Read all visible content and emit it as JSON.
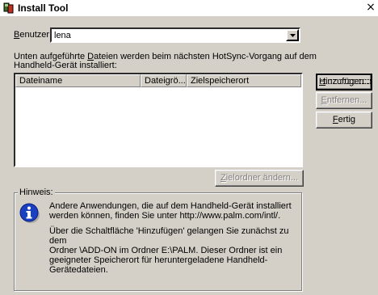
{
  "window": {
    "title": "Install Tool",
    "close_glyph": "×",
    "icon": "install-tool-icon"
  },
  "user": {
    "label_prefix": "",
    "label_accel": "B",
    "label_rest": "enutzer:",
    "value": "lena"
  },
  "description": {
    "line1_pre": "Unten aufgeführte ",
    "line1_accel": "D",
    "line1_post": "ateien werden beim nächsten HotSync-Vorgang auf dem",
    "line2": "Handheld-Gerät installiert:"
  },
  "file_list": {
    "columns": [
      "Dateiname",
      "Dateigrö...",
      "Zielspeicherort"
    ],
    "rows": []
  },
  "buttons": {
    "add_accel": "H",
    "add_rest": "inzufügen...",
    "remove_accel": "E",
    "remove_rest": "ntfernen...",
    "done_accel": "F",
    "done_rest": "ertig",
    "change_folder_accel": "Z",
    "change_folder_rest": "ielordner ändern..."
  },
  "hint": {
    "title": "Hinweis:",
    "p1_line1": "Andere Anwendungen, die auf dem Handheld-Gerät installiert",
    "p1_line2": "werden können, finden Sie unter http://www.palm.com/intl/.",
    "p2_line1": "Über die Schaltfläche 'Hinzufügen' gelangen Sie zunächst zu dem",
    "p2_line2": "Ordner \\ADD-ON im Ordner E:\\PALM. Dieser Ordner ist ein",
    "p2_line3": "geeigneter Speicherort für heruntergeladene Handheld-Gerätedateien."
  },
  "colors": {
    "dialog_bg": "#d4d0c8",
    "info_icon": "#1a3fbf",
    "disabled_text": "#808080"
  }
}
